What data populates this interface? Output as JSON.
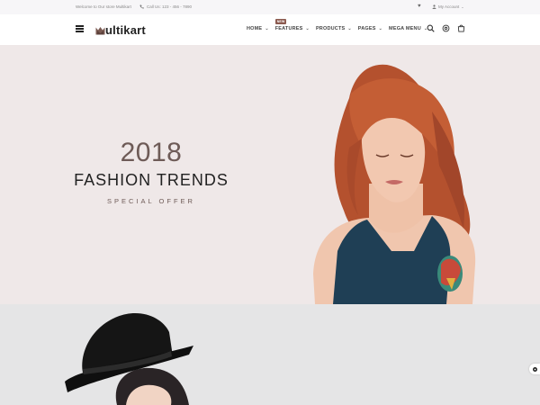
{
  "topbar": {
    "welcome": "Welcome to Our store Multikart",
    "phone": "Call Us: 123 - 456 - 7890",
    "account": "My Account"
  },
  "header": {
    "logo_rest": "ultikart",
    "nav": [
      {
        "label": "HOME"
      },
      {
        "label": "FEATURES",
        "badge": "NEW"
      },
      {
        "label": "PRODUCTS"
      },
      {
        "label": "PAGES"
      },
      {
        "label": "MEGA MENU"
      }
    ]
  },
  "hero": {
    "year": "2018",
    "title": "FASHION TRENDS",
    "offer": "SPECIAL OFFER"
  },
  "colors": {
    "accent": "#6e5b57",
    "badge": "#8b5a4f",
    "hero_bg": "#efe8e8",
    "hero2_bg": "#e5e5e6"
  },
  "icons": [
    "phone-icon",
    "heart-icon",
    "user-icon",
    "hamburger-icon",
    "search-icon",
    "settings-icon",
    "cart-icon",
    "gear-icon"
  ]
}
